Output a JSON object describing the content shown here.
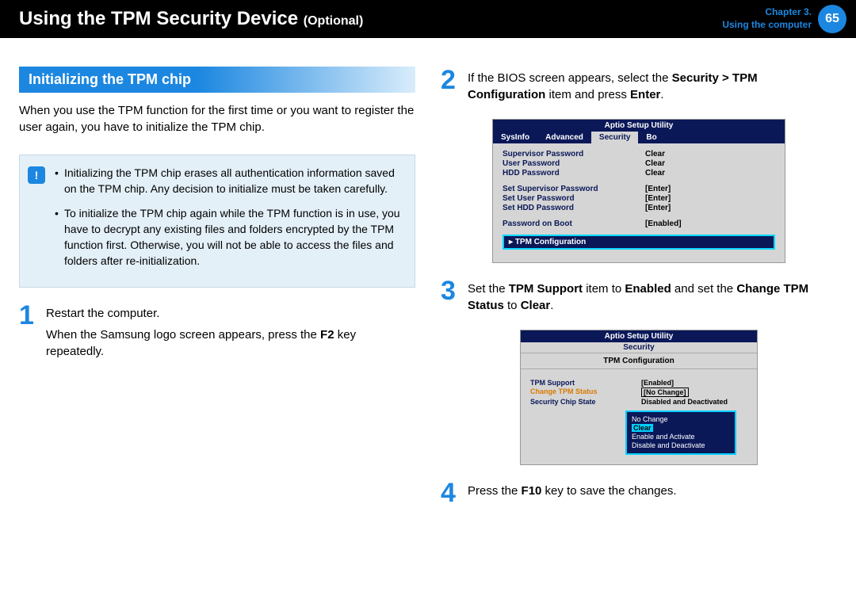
{
  "header": {
    "title": "Using the TPM Security Device",
    "optional": "(Optional)",
    "chapter_label": "Chapter 3.",
    "chapter_sub": "Using the computer",
    "page_no": "65"
  },
  "section_heading": "Initializing the TPM chip",
  "intro": "When you use the TPM function for the first time or you want to register the user again, you have to initialize the TPM chip.",
  "notices": [
    "Initializing the TPM chip erases all authentication information saved on the TPM chip. Any decision to initialize must be taken carefully.",
    "To initialize the TPM chip again while the TPM function is in use, you have to decrypt any existing files and folders encrypted by the TPM function first. Otherwise, you will not be able to access the files and folders after re-initialization."
  ],
  "steps": {
    "s1a": "Restart the computer.",
    "s1b_pre": "When the Samsung logo screen appears, press the ",
    "s1b_key": "F2",
    "s1b_post": " key repeatedly.",
    "s2_pre": "If the BIOS screen appears, select the ",
    "s2_b1": "Security > TPM Configuration",
    "s2_mid": " item and press ",
    "s2_b2": "Enter",
    "s2_end": ".",
    "s3_pre": "Set the ",
    "s3_b1": "TPM Support",
    "s3_mid1": " item to ",
    "s3_b2": "Enabled",
    "s3_mid2": " and set the ",
    "s3_b3": "Change TPM Status",
    "s3_mid3": " to ",
    "s3_b4": "Clear",
    "s3_end": ".",
    "s4_pre": "Press the ",
    "s4_b1": "F10",
    "s4_post": " key to save the changes."
  },
  "bios1": {
    "title": "Aptio Setup Utility",
    "tabs": [
      "SysInfo",
      "Advanced",
      "Security",
      "Bo"
    ],
    "rows": [
      {
        "label": "Supervisor Password",
        "value": "Clear"
      },
      {
        "label": "User Password",
        "value": "Clear"
      },
      {
        "label": "HDD Password",
        "value": "Clear"
      }
    ],
    "rows2": [
      {
        "label": "Set Supervisor Password",
        "value": "[Enter]"
      },
      {
        "label": "Set User Password",
        "value": "[Enter]"
      },
      {
        "label": "Set HDD Password",
        "value": "[Enter]"
      }
    ],
    "rows3": [
      {
        "label": "Password on Boot",
        "value": "[Enabled]"
      }
    ],
    "highlight": "TPM Configuration"
  },
  "bios2": {
    "title": "Aptio Setup Utility",
    "tab": "Security",
    "subtitle": "TPM Configuration",
    "rows": [
      {
        "label": "TPM Support",
        "value": "[Enabled]",
        "cls": ""
      },
      {
        "label": "Change TPM Status",
        "value": "[No Change]",
        "cls": "orange",
        "boxed": true
      },
      {
        "label": "Security Chip State",
        "value": "Disabled and Deactivated",
        "cls": ""
      }
    ],
    "options": [
      "No Change",
      "Clear",
      "Enable and Activate",
      "Disable and Deactivate"
    ],
    "selected": "Clear"
  }
}
